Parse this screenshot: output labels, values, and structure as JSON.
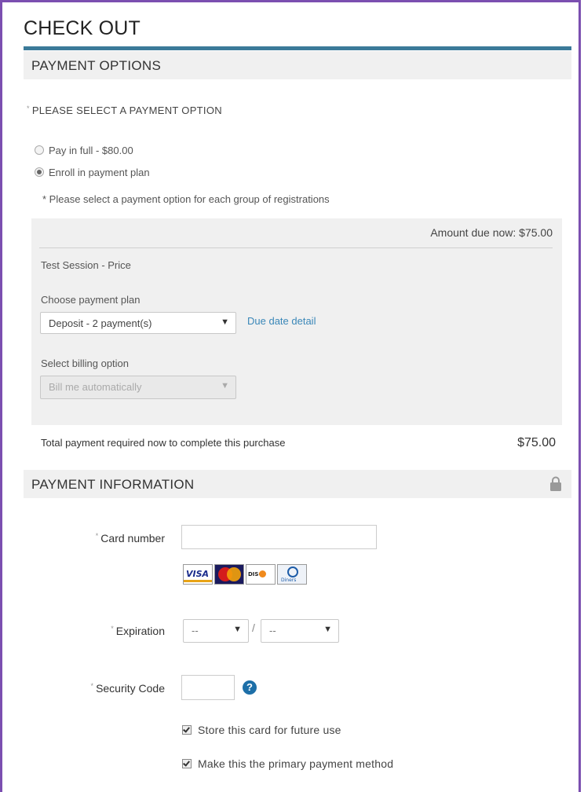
{
  "page": {
    "title": "CHECK OUT",
    "accent_color": "#3b7a99",
    "frame_color": "#7b4fb0"
  },
  "payment_options": {
    "header": "PAYMENT OPTIONS",
    "required_label": "PLEASE SELECT A PAYMENT OPTION",
    "required_marker": "*",
    "options": [
      {
        "label": "Pay in full - $80.00",
        "selected": false
      },
      {
        "label": "Enroll in payment plan",
        "selected": true
      }
    ],
    "note": "* Please select a payment option for each group of registrations",
    "plan": {
      "amount_due": "Amount due now: $75.00",
      "session_name": "Test Session - Price",
      "choose_plan_label": "Choose payment plan",
      "plan_value": "Deposit - 2 payment(s)",
      "due_date_link": "Due date detail",
      "billing_label": "Select billing option",
      "billing_value": "Bill me automatically"
    },
    "total_label": "Total payment required now to complete this purchase",
    "total_value": "$75.00"
  },
  "payment_information": {
    "header": "PAYMENT INFORMATION",
    "lock_icon": "lock-icon",
    "card_number_label": "Card number",
    "card_number_value": "",
    "card_brands": [
      "VISA",
      "MasterCard",
      "DISCOVER",
      "Diners Club"
    ],
    "expiration_label": "Expiration",
    "exp_month_value": "--",
    "exp_year_value": "--",
    "exp_separator": "/",
    "security_code_label": "Security Code",
    "security_code_value": "",
    "help_icon": "question-icon",
    "help_glyph": "?",
    "checkboxes": [
      {
        "label": "Store this card for future use",
        "checked": true
      },
      {
        "label": "Make this the primary payment method",
        "checked": true
      }
    ]
  }
}
